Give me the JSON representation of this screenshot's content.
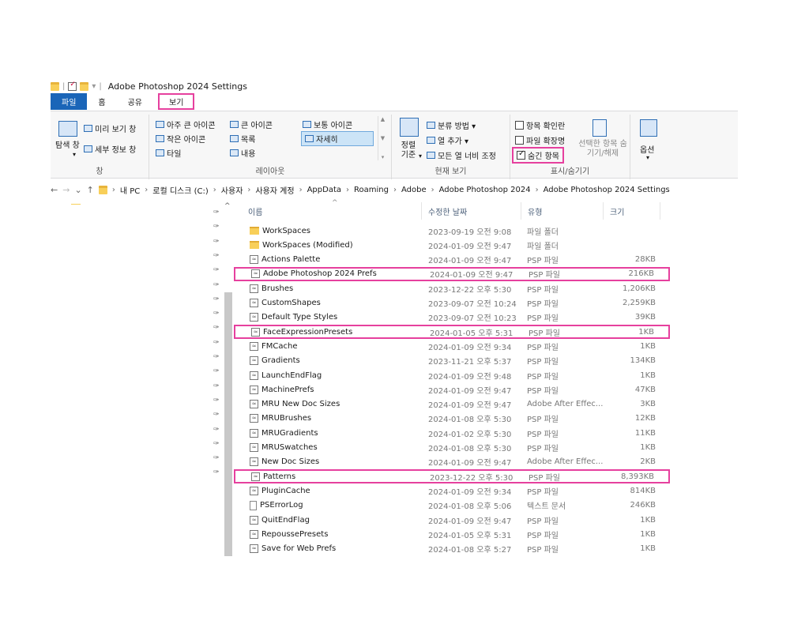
{
  "window": {
    "title": "Adobe Photoshop 2024 Settings",
    "qa_sep": "|",
    "qa_dropdown": "▾"
  },
  "tabs": [
    {
      "label": "파일"
    },
    {
      "label": "홈"
    },
    {
      "label": "공유"
    },
    {
      "label": "보기"
    }
  ],
  "ribbon": {
    "panes": {
      "nav_pane": "탐색 창",
      "nav_pane_caret": "▾",
      "preview_pane": "미리 보기 창",
      "details_pane": "세부 정보 창",
      "group_label": "창"
    },
    "layout": {
      "items": [
        "아주 큰 아이콘",
        "큰 아이콘",
        "보통 아이콘",
        "작은 아이콘",
        "목록",
        "자세히",
        "타일",
        "내용"
      ],
      "group_label": "레이아웃"
    },
    "current_view": {
      "sort_by": "정렬 기준",
      "sort_caret": "▾",
      "group_by": "분류 방법 ▾",
      "add_columns": "열 추가 ▾",
      "size_all_columns": "모든 열 너비 조정",
      "group_label": "현재 보기"
    },
    "show_hide": {
      "item_checkboxes": "항목 확인란",
      "file_extensions": "파일 확장명",
      "hidden_items": "숨긴 항목",
      "hide_selected": "선택한 항목 숨기기/해제",
      "group_label": "표시/숨기기"
    },
    "options": {
      "label": "옵션",
      "caret": "▾"
    }
  },
  "address": {
    "back": "←",
    "forward": "→",
    "recent": "⌄",
    "up": "↑",
    "sep": "›",
    "crumbs": [
      "내 PC",
      "로컬 디스크 (C:)",
      "사용자",
      "사용자 계정",
      "AppData",
      "Roaming",
      "Adobe",
      "Adobe Photoshop 2024",
      "Adobe Photoshop 2024 Settings"
    ]
  },
  "nav_pane": {
    "pin_glyph": "📌",
    "collapse_glyph": "^"
  },
  "columns": {
    "name": "이름",
    "date": "수정한 날짜",
    "type": "유형",
    "size": "크기",
    "sort_caret": "^"
  },
  "files": [
    {
      "name": "WorkSpaces",
      "date": "2023-09-19 오전 9:08",
      "type": "파일 폴더",
      "size": "",
      "icon": "folder"
    },
    {
      "name": "WorkSpaces (Modified)",
      "date": "2024-01-09 오전 9:47",
      "type": "파일 폴더",
      "size": "",
      "icon": "folder"
    },
    {
      "name": "Actions Palette",
      "date": "2024-01-09 오전 9:47",
      "type": "PSP 파일",
      "size": "28KB",
      "icon": "psp"
    },
    {
      "name": "Adobe Photoshop 2024 Prefs",
      "date": "2024-01-09 오전 9:47",
      "type": "PSP 파일",
      "size": "216KB",
      "icon": "psp"
    },
    {
      "name": "Brushes",
      "date": "2023-12-22 오후 5:30",
      "type": "PSP 파일",
      "size": "1,206KB",
      "icon": "psp"
    },
    {
      "name": "CustomShapes",
      "date": "2023-09-07 오전 10:24",
      "type": "PSP 파일",
      "size": "2,259KB",
      "icon": "psp"
    },
    {
      "name": "Default Type Styles",
      "date": "2023-09-07 오전 10:23",
      "type": "PSP 파일",
      "size": "39KB",
      "icon": "psp"
    },
    {
      "name": "FaceExpressionPresets",
      "date": "2024-01-05 오후 5:31",
      "type": "PSP 파일",
      "size": "1KB",
      "icon": "psp"
    },
    {
      "name": "FMCache",
      "date": "2024-01-09 오전 9:34",
      "type": "PSP 파일",
      "size": "1KB",
      "icon": "psp"
    },
    {
      "name": "Gradients",
      "date": "2023-11-21 오후 5:37",
      "type": "PSP 파일",
      "size": "134KB",
      "icon": "psp"
    },
    {
      "name": "LaunchEndFlag",
      "date": "2024-01-09 오전 9:48",
      "type": "PSP 파일",
      "size": "1KB",
      "icon": "psp"
    },
    {
      "name": "MachinePrefs",
      "date": "2024-01-09 오전 9:47",
      "type": "PSP 파일",
      "size": "47KB",
      "icon": "psp"
    },
    {
      "name": "MRU New Doc Sizes",
      "date": "2024-01-09 오전 9:47",
      "type": "Adobe After Effec...",
      "size": "3KB",
      "icon": "doc"
    },
    {
      "name": "MRUBrushes",
      "date": "2024-01-08 오후 5:30",
      "type": "PSP 파일",
      "size": "12KB",
      "icon": "psp"
    },
    {
      "name": "MRUGradients",
      "date": "2024-01-02 오후 5:30",
      "type": "PSP 파일",
      "size": "11KB",
      "icon": "psp"
    },
    {
      "name": "MRUSwatches",
      "date": "2024-01-08 오후 5:30",
      "type": "PSP 파일",
      "size": "1KB",
      "icon": "psp"
    },
    {
      "name": "New Doc Sizes",
      "date": "2024-01-09 오전 9:47",
      "type": "Adobe After Effec...",
      "size": "2KB",
      "icon": "doc"
    },
    {
      "name": "Patterns",
      "date": "2023-12-22 오후 5:30",
      "type": "PSP 파일",
      "size": "8,393KB",
      "icon": "psp"
    },
    {
      "name": "PluginCache",
      "date": "2024-01-09 오전 9:34",
      "type": "PSP 파일",
      "size": "814KB",
      "icon": "psp"
    },
    {
      "name": "PSErrorLog",
      "date": "2024-01-08 오후 5:06",
      "type": "텍스트 문서",
      "size": "246KB",
      "icon": "txt"
    },
    {
      "name": "QuitEndFlag",
      "date": "2024-01-09 오전 9:47",
      "type": "PSP 파일",
      "size": "1KB",
      "icon": "psp"
    },
    {
      "name": "RepoussePresets",
      "date": "2024-01-05 오후 5:31",
      "type": "PSP 파일",
      "size": "1KB",
      "icon": "psp"
    },
    {
      "name": "Save for Web Prefs",
      "date": "2024-01-08 오후 5:27",
      "type": "PSP 파일",
      "size": "1KB",
      "icon": "psp"
    }
  ],
  "highlighted_rows": [
    "Adobe Photoshop 2024 Prefs",
    "FaceExpressionPresets",
    "Patterns"
  ],
  "colors": {
    "highlight": "#e6409e",
    "file_tab": "#1a65b8",
    "folder": "#f8cf59"
  }
}
